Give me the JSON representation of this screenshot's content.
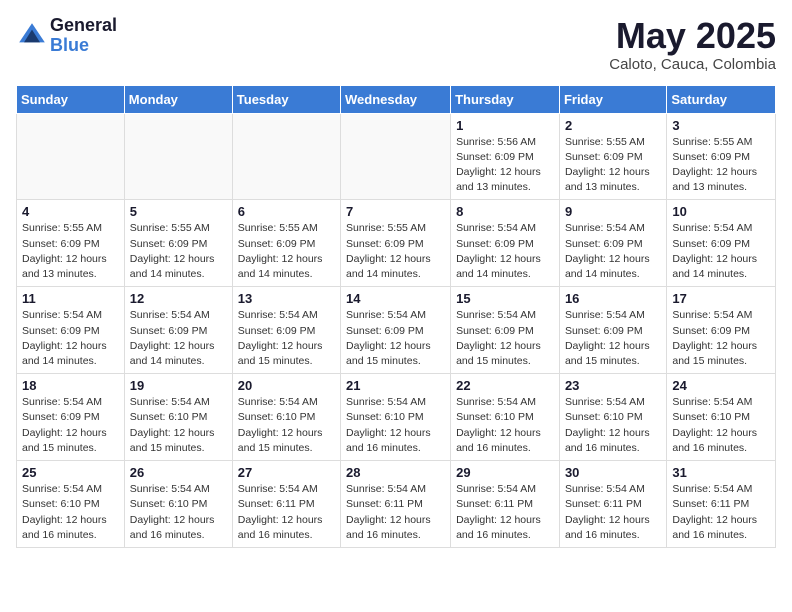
{
  "header": {
    "logo_general": "General",
    "logo_blue": "Blue",
    "month_year": "May 2025",
    "location": "Caloto, Cauca, Colombia"
  },
  "weekdays": [
    "Sunday",
    "Monday",
    "Tuesday",
    "Wednesday",
    "Thursday",
    "Friday",
    "Saturday"
  ],
  "weeks": [
    [
      {
        "day": "",
        "detail": ""
      },
      {
        "day": "",
        "detail": ""
      },
      {
        "day": "",
        "detail": ""
      },
      {
        "day": "",
        "detail": ""
      },
      {
        "day": "1",
        "detail": "Sunrise: 5:56 AM\nSunset: 6:09 PM\nDaylight: 12 hours\nand 13 minutes."
      },
      {
        "day": "2",
        "detail": "Sunrise: 5:55 AM\nSunset: 6:09 PM\nDaylight: 12 hours\nand 13 minutes."
      },
      {
        "day": "3",
        "detail": "Sunrise: 5:55 AM\nSunset: 6:09 PM\nDaylight: 12 hours\nand 13 minutes."
      }
    ],
    [
      {
        "day": "4",
        "detail": "Sunrise: 5:55 AM\nSunset: 6:09 PM\nDaylight: 12 hours\nand 13 minutes."
      },
      {
        "day": "5",
        "detail": "Sunrise: 5:55 AM\nSunset: 6:09 PM\nDaylight: 12 hours\nand 14 minutes."
      },
      {
        "day": "6",
        "detail": "Sunrise: 5:55 AM\nSunset: 6:09 PM\nDaylight: 12 hours\nand 14 minutes."
      },
      {
        "day": "7",
        "detail": "Sunrise: 5:55 AM\nSunset: 6:09 PM\nDaylight: 12 hours\nand 14 minutes."
      },
      {
        "day": "8",
        "detail": "Sunrise: 5:54 AM\nSunset: 6:09 PM\nDaylight: 12 hours\nand 14 minutes."
      },
      {
        "day": "9",
        "detail": "Sunrise: 5:54 AM\nSunset: 6:09 PM\nDaylight: 12 hours\nand 14 minutes."
      },
      {
        "day": "10",
        "detail": "Sunrise: 5:54 AM\nSunset: 6:09 PM\nDaylight: 12 hours\nand 14 minutes."
      }
    ],
    [
      {
        "day": "11",
        "detail": "Sunrise: 5:54 AM\nSunset: 6:09 PM\nDaylight: 12 hours\nand 14 minutes."
      },
      {
        "day": "12",
        "detail": "Sunrise: 5:54 AM\nSunset: 6:09 PM\nDaylight: 12 hours\nand 14 minutes."
      },
      {
        "day": "13",
        "detail": "Sunrise: 5:54 AM\nSunset: 6:09 PM\nDaylight: 12 hours\nand 15 minutes."
      },
      {
        "day": "14",
        "detail": "Sunrise: 5:54 AM\nSunset: 6:09 PM\nDaylight: 12 hours\nand 15 minutes."
      },
      {
        "day": "15",
        "detail": "Sunrise: 5:54 AM\nSunset: 6:09 PM\nDaylight: 12 hours\nand 15 minutes."
      },
      {
        "day": "16",
        "detail": "Sunrise: 5:54 AM\nSunset: 6:09 PM\nDaylight: 12 hours\nand 15 minutes."
      },
      {
        "day": "17",
        "detail": "Sunrise: 5:54 AM\nSunset: 6:09 PM\nDaylight: 12 hours\nand 15 minutes."
      }
    ],
    [
      {
        "day": "18",
        "detail": "Sunrise: 5:54 AM\nSunset: 6:09 PM\nDaylight: 12 hours\nand 15 minutes."
      },
      {
        "day": "19",
        "detail": "Sunrise: 5:54 AM\nSunset: 6:10 PM\nDaylight: 12 hours\nand 15 minutes."
      },
      {
        "day": "20",
        "detail": "Sunrise: 5:54 AM\nSunset: 6:10 PM\nDaylight: 12 hours\nand 15 minutes."
      },
      {
        "day": "21",
        "detail": "Sunrise: 5:54 AM\nSunset: 6:10 PM\nDaylight: 12 hours\nand 16 minutes."
      },
      {
        "day": "22",
        "detail": "Sunrise: 5:54 AM\nSunset: 6:10 PM\nDaylight: 12 hours\nand 16 minutes."
      },
      {
        "day": "23",
        "detail": "Sunrise: 5:54 AM\nSunset: 6:10 PM\nDaylight: 12 hours\nand 16 minutes."
      },
      {
        "day": "24",
        "detail": "Sunrise: 5:54 AM\nSunset: 6:10 PM\nDaylight: 12 hours\nand 16 minutes."
      }
    ],
    [
      {
        "day": "25",
        "detail": "Sunrise: 5:54 AM\nSunset: 6:10 PM\nDaylight: 12 hours\nand 16 minutes."
      },
      {
        "day": "26",
        "detail": "Sunrise: 5:54 AM\nSunset: 6:10 PM\nDaylight: 12 hours\nand 16 minutes."
      },
      {
        "day": "27",
        "detail": "Sunrise: 5:54 AM\nSunset: 6:11 PM\nDaylight: 12 hours\nand 16 minutes."
      },
      {
        "day": "28",
        "detail": "Sunrise: 5:54 AM\nSunset: 6:11 PM\nDaylight: 12 hours\nand 16 minutes."
      },
      {
        "day": "29",
        "detail": "Sunrise: 5:54 AM\nSunset: 6:11 PM\nDaylight: 12 hours\nand 16 minutes."
      },
      {
        "day": "30",
        "detail": "Sunrise: 5:54 AM\nSunset: 6:11 PM\nDaylight: 12 hours\nand 16 minutes."
      },
      {
        "day": "31",
        "detail": "Sunrise: 5:54 AM\nSunset: 6:11 PM\nDaylight: 12 hours\nand 16 minutes."
      }
    ]
  ]
}
